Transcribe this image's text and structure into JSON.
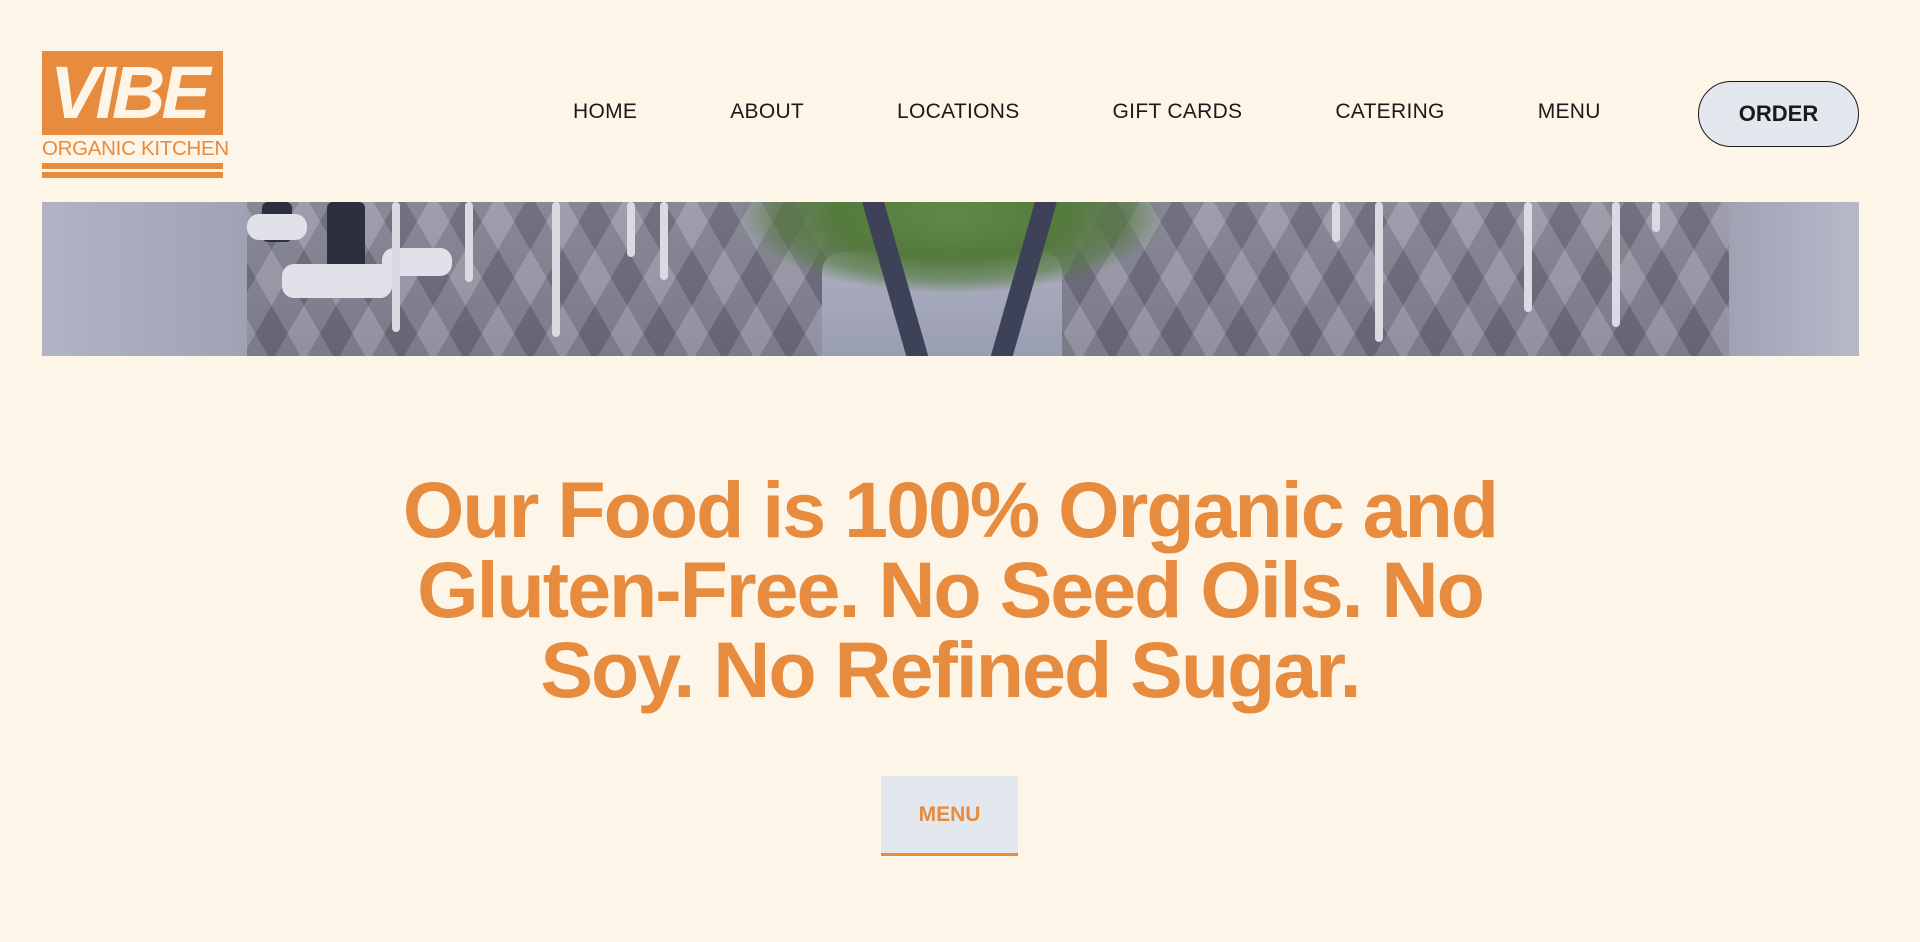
{
  "brand": {
    "logo_main": "VIBE",
    "logo_sub": "ORGANIC KITCHEN",
    "accent": "#e78c3e",
    "background": "#fdf5e7",
    "button_bg": "#e2e8ee"
  },
  "nav": {
    "items": [
      {
        "label": "HOME"
      },
      {
        "label": "ABOUT"
      },
      {
        "label": "LOCATIONS"
      },
      {
        "label": "GIFT CARDS"
      },
      {
        "label": "CATERING"
      },
      {
        "label": "MENU"
      }
    ],
    "order_label": "ORDER"
  },
  "hero": {
    "headline": "Our Food is 100% Organic and Gluten-Free. No Seed Oils. No Soy. No Refined Sugar.",
    "cta_label": "MENU"
  }
}
